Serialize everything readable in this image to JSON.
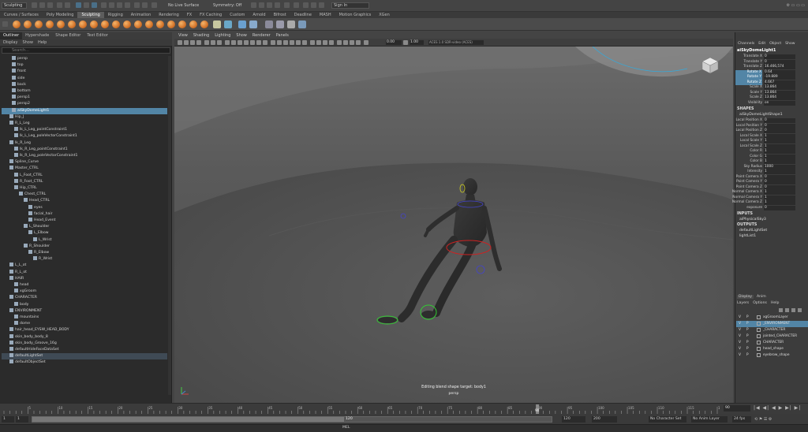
{
  "status_line": {
    "menu_set": "Sculpting",
    "no_live_surface": "No Live Surface",
    "symmetry": "Symmetry: Off",
    "sign_in": "Sign In"
  },
  "shelf_tabs": [
    "Curves / Surfaces",
    "Poly Modeling",
    "Sculpting",
    "Rigging",
    "Animation",
    "Rendering",
    "FX",
    "FX Caching",
    "Custom",
    "Arnold",
    "Bifrost",
    "Deadline",
    "MASH",
    "Motion Graphics",
    "XGen"
  ],
  "left_panel": {
    "tabs": [
      "Outliner",
      "Hypershade",
      "Shape Editor",
      "Text Editor"
    ],
    "menu": [
      "Display",
      "Show",
      "Help"
    ],
    "search_placeholder": "Search...",
    "outliner_items": [
      {
        "label": "persp",
        "indent": 3
      },
      {
        "label": "top",
        "indent": 3
      },
      {
        "label": "front",
        "indent": 3
      },
      {
        "label": "side",
        "indent": 3
      },
      {
        "label": "back",
        "indent": 3
      },
      {
        "label": "bottom",
        "indent": 3
      },
      {
        "label": "persp1",
        "indent": 3
      },
      {
        "label": "persp2",
        "indent": 3
      },
      {
        "label": "aiSkyDomeLight1",
        "indent": 3,
        "selected": true
      },
      {
        "label": "Hip_J",
        "indent": 2
      },
      {
        "label": "R_L_Leg",
        "indent": 2
      },
      {
        "label": "lk_L_Leg_pointConstraint1",
        "indent": 4
      },
      {
        "label": "lk_L_Leg_poleVectorConstraint1",
        "indent": 4
      },
      {
        "label": "lk_R_Leg",
        "indent": 2
      },
      {
        "label": "lk_R_Leg_pointConstraint1",
        "indent": 4
      },
      {
        "label": "lk_R_Leg_poleVectorConstraint1",
        "indent": 4
      },
      {
        "label": "Spline_Curve",
        "indent": 2
      },
      {
        "label": "Master_CTRL",
        "indent": 2
      },
      {
        "label": "L_Foot_CTRL",
        "indent": 4
      },
      {
        "label": "R_Foot_CTRL",
        "indent": 4
      },
      {
        "label": "Hip_CTRL",
        "indent": 4
      },
      {
        "label": "Chest_CTRL",
        "indent": 6
      },
      {
        "label": "Head_CTRL",
        "indent": 8
      },
      {
        "label": "eyes",
        "indent": 10
      },
      {
        "label": "facial_hair",
        "indent": 10
      },
      {
        "label": "Head_Event",
        "indent": 10
      },
      {
        "label": "L_Shoulder",
        "indent": 8
      },
      {
        "label": "L_Elbow",
        "indent": 10
      },
      {
        "label": "L_Wrist",
        "indent": 12
      },
      {
        "label": "R_Shoulder",
        "indent": 8
      },
      {
        "label": "R_Elbow",
        "indent": 10
      },
      {
        "label": "R_Wrist",
        "indent": 12
      },
      {
        "label": "L_L_ot",
        "indent": 2
      },
      {
        "label": "R_L_ot",
        "indent": 2
      },
      {
        "label": "HAIR",
        "indent": 2
      },
      {
        "label": "head",
        "indent": 4
      },
      {
        "label": "xgGroom",
        "indent": 4
      },
      {
        "label": "CHARACTER",
        "indent": 2
      },
      {
        "label": "body",
        "indent": 4
      },
      {
        "label": "ENVIRONMENT",
        "indent": 2
      },
      {
        "label": "mountains",
        "indent": 4
      },
      {
        "label": "dome",
        "indent": 4
      },
      {
        "label": "hair_head_EYSW_HEAD_BODY",
        "indent": 2
      },
      {
        "label": "skin_body_body_8",
        "indent": 2
      },
      {
        "label": "skin_body_Groove_16g",
        "indent": 2
      },
      {
        "label": "defaultHideFaceDataSet",
        "indent": 2
      },
      {
        "label": "defaultLightSet",
        "indent": 2,
        "selected2": true
      },
      {
        "label": "defaultObjectSet",
        "indent": 2
      }
    ]
  },
  "viewport": {
    "menu": [
      "View",
      "Shading",
      "Lighting",
      "Show",
      "Renderer",
      "Panels"
    ],
    "field1": "0.00",
    "field2": "1.00",
    "color_space": "ACES 1.0 SDR-video (ACES)",
    "edit_message": "Editing blend shape target: body1",
    "camera_name": "persp"
  },
  "channel_box": {
    "tabs": [
      "Channels",
      "Edit",
      "Object",
      "Show"
    ],
    "object_name": "aiSkyDomeLight1",
    "transform_attrs": [
      {
        "name": "Translate X",
        "value": "0"
      },
      {
        "name": "Translate Y",
        "value": "0"
      },
      {
        "name": "Translate Z",
        "value": "16.466,574"
      },
      {
        "name": "Rotate X",
        "value": "0.64",
        "hl": true
      },
      {
        "name": "Rotate Y",
        "value": "-19.889",
        "hl": true
      },
      {
        "name": "Rotate Z",
        "value": "4.667",
        "hl": true
      },
      {
        "name": "Scale X",
        "value": "13.864"
      },
      {
        "name": "Scale Y",
        "value": "13.864"
      },
      {
        "name": "Scale Z",
        "value": "13.864"
      },
      {
        "name": "Visibility",
        "value": "on"
      }
    ],
    "shapes_header": "SHAPES",
    "shape_name": "aiSkyDomeLightShape1",
    "shape_attrs": [
      {
        "name": "Local Position X",
        "value": "0"
      },
      {
        "name": "Local Position Y",
        "value": "0"
      },
      {
        "name": "Local Position Z",
        "value": "0"
      },
      {
        "name": "Local Scale X",
        "value": "1"
      },
      {
        "name": "Local Scale Y",
        "value": "1"
      },
      {
        "name": "Local Scale Z",
        "value": "1"
      },
      {
        "name": "Color R",
        "value": "1"
      },
      {
        "name": "Color G",
        "value": "1"
      },
      {
        "name": "Color B",
        "value": "1"
      },
      {
        "name": "Sky Radius",
        "value": "1000"
      },
      {
        "name": "Intensity",
        "value": "1"
      },
      {
        "name": "Point Camera X",
        "value": "0"
      },
      {
        "name": "Point Camera Y",
        "value": "0"
      },
      {
        "name": "Point Camera Z",
        "value": "0"
      },
      {
        "name": "Normal Camera X",
        "value": "1"
      },
      {
        "name": "Normal Camera Y",
        "value": "1"
      },
      {
        "name": "Normal Camera Z",
        "value": "1"
      },
      {
        "name": "exposure",
        "value": "0"
      }
    ],
    "inputs_header": "INPUTS",
    "inputs": [
      "aiPhysicalSky3"
    ],
    "outputs_header": "OUTPUTS",
    "outputs": [
      "defaultLightSet",
      "lightList1"
    ]
  },
  "layer_editor": {
    "tabs": [
      "Display",
      "Anim"
    ],
    "menu": [
      "Layers",
      "Options",
      "Help"
    ],
    "layers": [
      {
        "v": "V",
        "p": "P",
        "name": "xgGroomLayer"
      },
      {
        "v": "V",
        "p": "P",
        "name": "_ENVIRONMENT",
        "selected": true
      },
      {
        "v": "V",
        "p": "P",
        "name": "_CHARACTER"
      },
      {
        "v": "V",
        "p": "P",
        "name": "jointed_CHARACTER"
      },
      {
        "v": "V",
        "p": "P",
        "name": "CHARACTER"
      },
      {
        "v": "V",
        "p": "P",
        "name": "head_shape"
      },
      {
        "v": "V",
        "p": "P",
        "name": "eyebrow_shape"
      }
    ]
  },
  "timeline": {
    "ticks": [
      "5",
      "10",
      "15",
      "20",
      "25",
      "30",
      "35",
      "40",
      "45",
      "50",
      "55",
      "60",
      "65",
      "70",
      "75",
      "80",
      "85",
      "90",
      "95",
      "100",
      "105",
      "110",
      "115",
      "120"
    ],
    "current_frame": "90",
    "playhead_frame": 90,
    "max_frame": 120,
    "frame_field": "90",
    "playback_controls": "|◀ ◀| ◀ ▶ ▶| ▶|"
  },
  "range": {
    "start": "1",
    "start_anim": "1",
    "end": "120",
    "end_anim": "200",
    "slider_end_label": "120",
    "slider_fraction": 0.6,
    "character_set": "No Character Set",
    "anim_layer": "No Anim Layer",
    "fps": "24 fps"
  },
  "command_line": {
    "mel_label": "MEL"
  }
}
